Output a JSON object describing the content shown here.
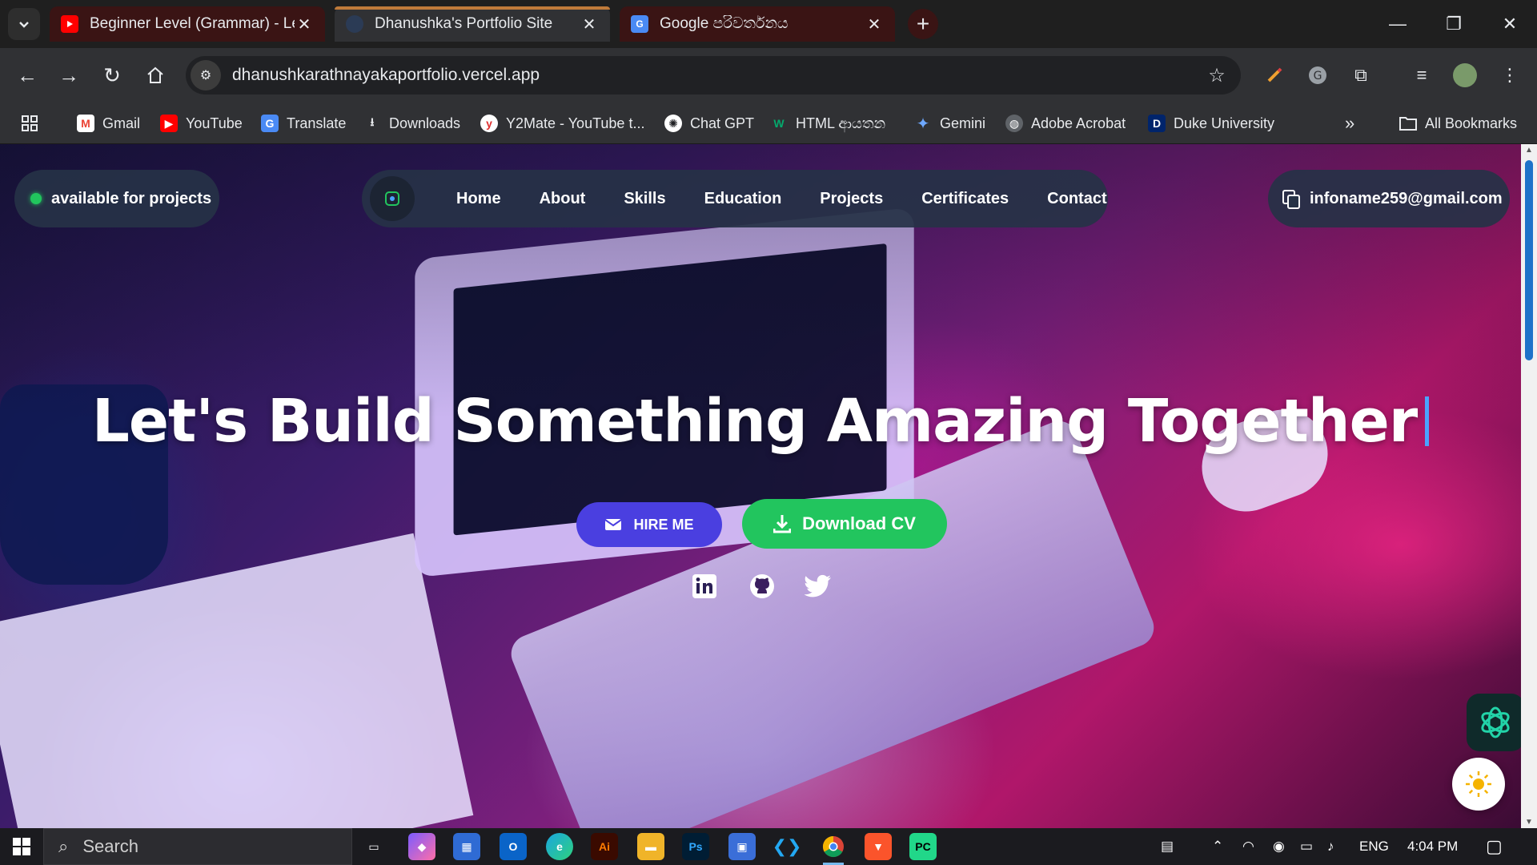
{
  "browser": {
    "tabs": [
      {
        "title": "Beginner Level (Grammar) - Les",
        "favicon": "youtube-icon",
        "color": "#ff0000"
      },
      {
        "title": "Dhanushka's Portfolio Site",
        "favicon": "portfolio-icon",
        "color": "#2b3b55"
      },
      {
        "title": "Google පරිවර්තනය",
        "favicon": "translate-icon",
        "color": "#4a8af4"
      }
    ],
    "url": "dhanushkarathnayakaportfolio.vercel.app",
    "bookmarks": [
      {
        "label": "Gmail",
        "icon": "gmail-icon"
      },
      {
        "label": "YouTube",
        "icon": "youtube-icon"
      },
      {
        "label": "Translate",
        "icon": "translate-icon"
      },
      {
        "label": "Downloads",
        "icon": "download-icon"
      },
      {
        "label": "Y2Mate - YouTube t...",
        "icon": "y2mate-icon"
      },
      {
        "label": "Chat GPT",
        "icon": "chatgpt-icon"
      },
      {
        "label": "HTML ආයතන",
        "icon": "w3-icon"
      },
      {
        "label": "Gemini",
        "icon": "gemini-icon"
      },
      {
        "label": "Adobe Acrobat",
        "icon": "globe-icon"
      },
      {
        "label": "Duke University",
        "icon": "duke-icon"
      }
    ],
    "all_bookmarks": "All Bookmarks",
    "overflow": "»"
  },
  "site": {
    "status": "available for projects",
    "nav": [
      "Home",
      "About",
      "Skills",
      "Education",
      "Projects",
      "Certificates",
      "Contact"
    ],
    "email": "infoname259@gmail.com",
    "headline": "Let's Build Something Amazing Together",
    "hire_label": "HIRE ME",
    "download_label": "Download CV",
    "social": [
      "linkedin-icon",
      "github-icon",
      "twitter-icon"
    ],
    "colors": {
      "hire": "#4a3fe0",
      "download": "#22c55e",
      "status_dot": "#21c55d"
    }
  },
  "taskbar": {
    "search_placeholder": "Search",
    "language": "ENG",
    "time": "4:04 PM"
  }
}
